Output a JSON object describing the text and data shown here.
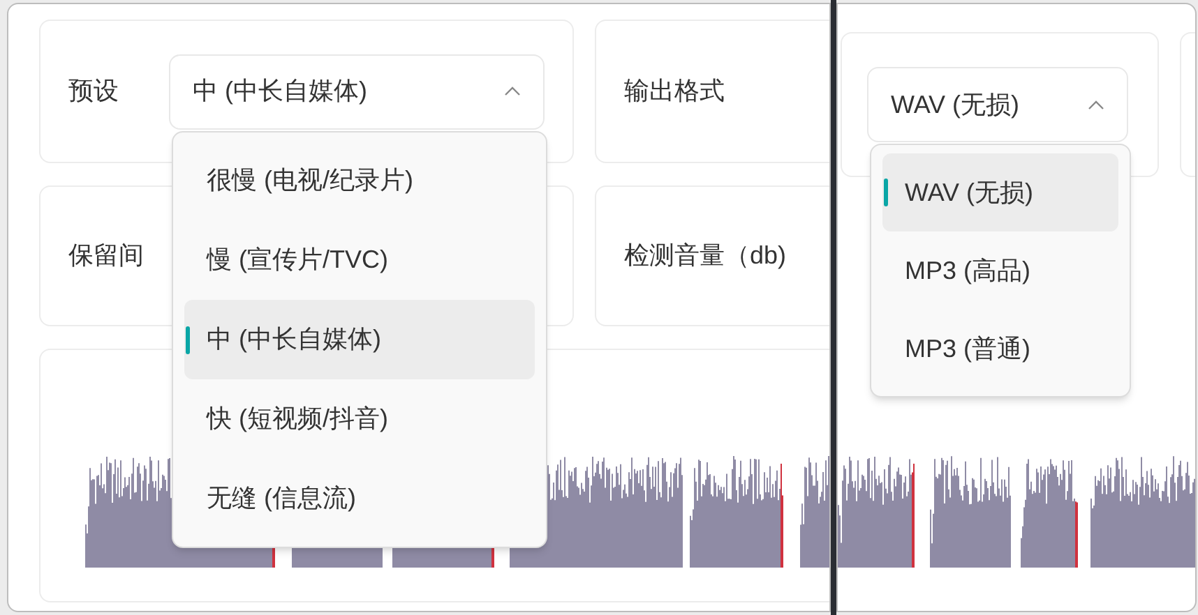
{
  "left_panel": {
    "preset": {
      "label": "预设",
      "value": "中 (中长自媒体)",
      "expanded": true,
      "options": [
        {
          "label": "很慢 (电视/纪录片)",
          "selected": false
        },
        {
          "label": "慢 (宣传片/TVC)",
          "selected": false
        },
        {
          "label": "中 (中长自媒体)",
          "selected": true
        },
        {
          "label": "快 (短视频/抖音)",
          "selected": false
        },
        {
          "label": "无缝 (信息流)",
          "selected": false
        }
      ]
    },
    "output_format": {
      "label": "输出格式"
    },
    "keep_gap": {
      "label": "保留间"
    },
    "detect_volume": {
      "label": "检测音量（db)"
    }
  },
  "right_panel": {
    "output_format": {
      "value": "WAV (无损)",
      "expanded": true,
      "options": [
        {
          "label": "WAV (无损)",
          "selected": true
        },
        {
          "label": "MP3 (高品)",
          "selected": false
        },
        {
          "label": "MP3 (普通)",
          "selected": false
        }
      ]
    }
  }
}
